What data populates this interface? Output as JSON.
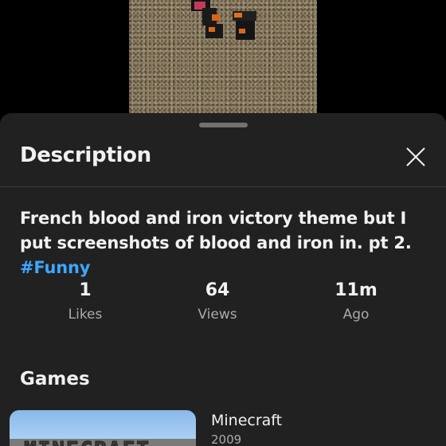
{
  "sheet": {
    "title": "Description",
    "close_icon": "close-icon"
  },
  "description": {
    "text": "French blood and iron victory theme but I put screenshots of blood and iron in. pt 2.",
    "hashtag": "#Funny"
  },
  "stats": [
    {
      "value": "1",
      "label": "Likes"
    },
    {
      "value": "64",
      "label": "Views"
    },
    {
      "value": "11m",
      "label": "Ago"
    }
  ],
  "games": {
    "title": "Games",
    "items": [
      {
        "name": "Minecraft",
        "year": "2009",
        "thumb_text": "MINECRAFT"
      }
    ]
  },
  "colors": {
    "sheet_bg": "#212121",
    "hashtag": "#3ea6ff",
    "secondary_text": "#aaaaaa"
  }
}
